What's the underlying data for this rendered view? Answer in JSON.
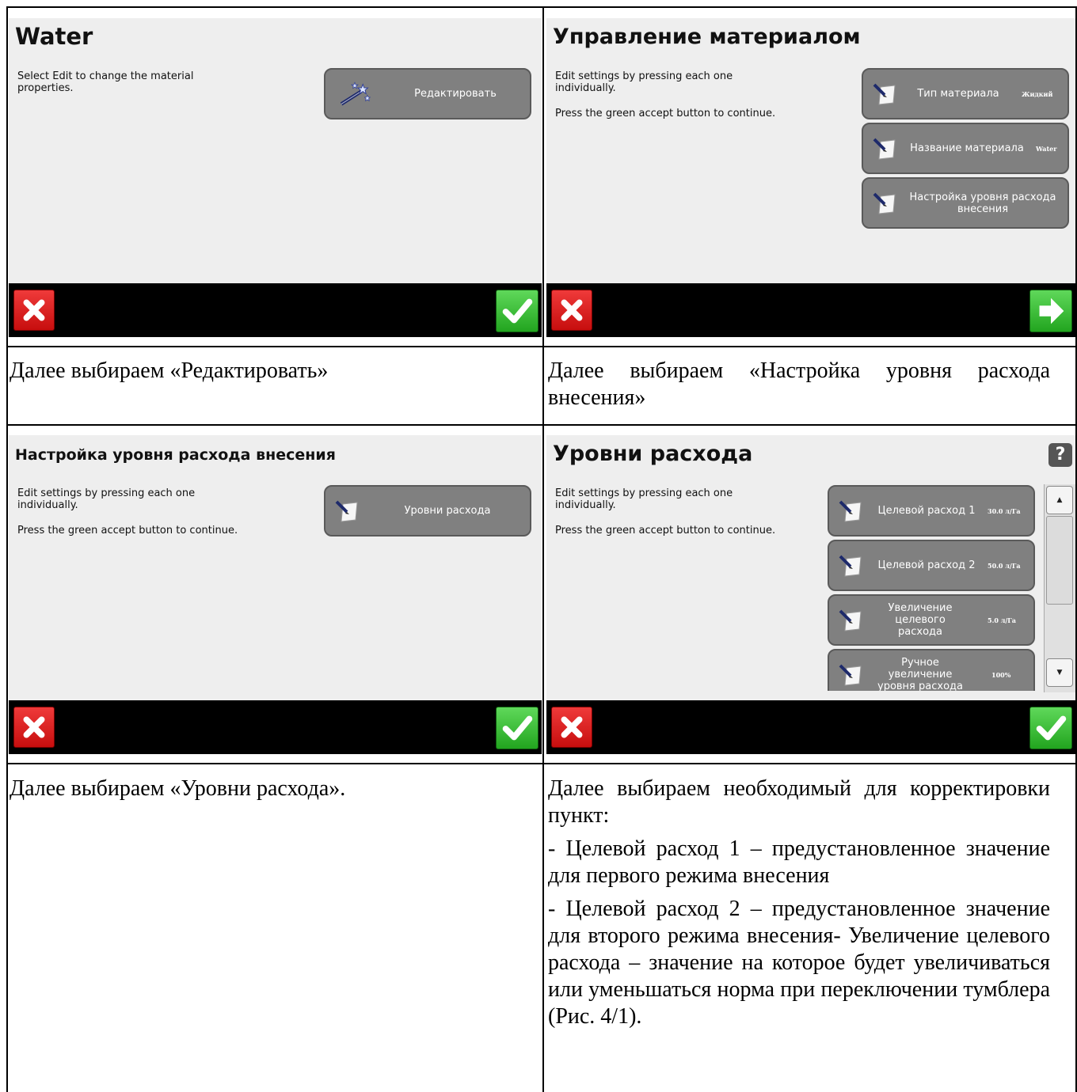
{
  "panel1": {
    "title": "Water",
    "desc": "Select Edit to change the material properties.",
    "button": "Редактировать",
    "caption": "Далее выбираем «Редактировать»"
  },
  "panel2": {
    "title": "Управление материалом",
    "desc1": "Edit settings by pressing each one individually.",
    "desc2": "Press the green accept button to continue.",
    "buttons": [
      {
        "label": "Тип материала",
        "value": "Жидкий"
      },
      {
        "label": "Название материала",
        "value": "Water"
      },
      {
        "label": "Настройка уровня расхода внесения",
        "value": ""
      }
    ],
    "caption": "Далее выбираем «Настройка уровня расхода внесения»"
  },
  "panel3": {
    "title": "Настройка уровня расхода внесения",
    "desc1": "Edit settings by pressing each one individually.",
    "desc2": "Press the green accept button to continue.",
    "button": "Уровни расхода",
    "caption": "Далее выбираем «Уровни расхода»."
  },
  "panel4": {
    "title": "Уровни расхода",
    "help": "?",
    "desc1": "Edit settings by pressing each one individually.",
    "desc2": "Press the green accept button to continue.",
    "buttons": [
      {
        "label": "Целевой расход 1",
        "value": "30.0 л/Га"
      },
      {
        "label": "Целевой расход 2",
        "value": "50.0 л/Га"
      },
      {
        "label": "Увеличение целевого расхода",
        "value": "5.0 л/Га"
      },
      {
        "label": "Ручное увеличение уровня расхода",
        "value": "100%"
      }
    ],
    "caption_lines": [
      "Далее выбираем необходимый для корректировки пункт:",
      "- Целевой расход 1 – предустановленное значение для первого режима внесения",
      "- Целевой расход 2 – предустановленное значение для второго режима внесения- Увеличение целевого расхода – значение на которое будет увеличиваться или уменьшаться норма при переключении тумблера (Рис. 4/1)."
    ]
  },
  "icons": {
    "cancel": "cancel-x-icon",
    "accept": "accept-check-icon",
    "next": "next-arrow-icon",
    "edit": "edit-pencil-icon",
    "wand": "magic-wand-icon"
  }
}
